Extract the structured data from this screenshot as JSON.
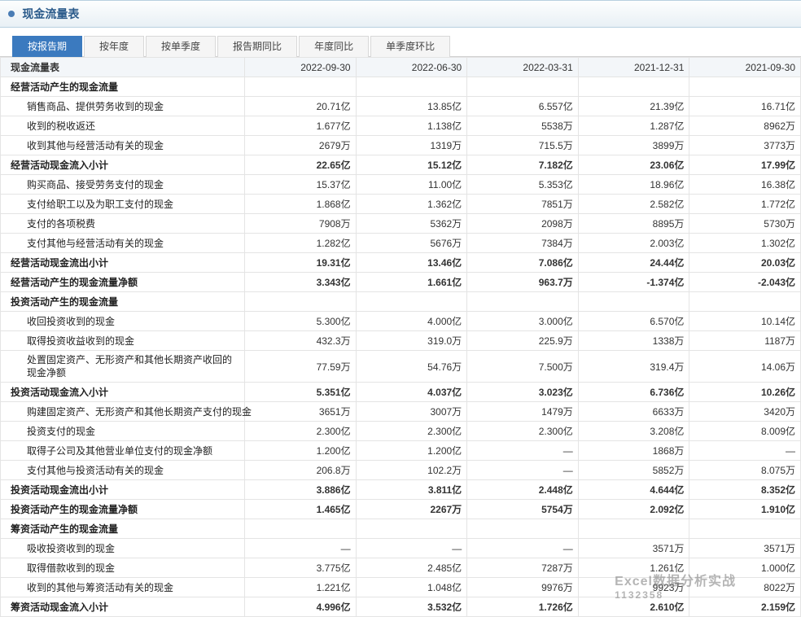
{
  "header": {
    "title": "现金流量表"
  },
  "tabs": [
    {
      "label": "按报告期",
      "active": true
    },
    {
      "label": "按年度",
      "active": false
    },
    {
      "label": "按单季度",
      "active": false
    },
    {
      "label": "报告期同比",
      "active": false
    },
    {
      "label": "年度同比",
      "active": false
    },
    {
      "label": "单季度环比",
      "active": false
    }
  ],
  "table": {
    "header_label": "现金流量表",
    "columns": [
      "2022-09-30",
      "2022-06-30",
      "2022-03-31",
      "2021-12-31",
      "2021-09-30"
    ],
    "rows": [
      {
        "label": "经营活动产生的现金流量",
        "bold": true,
        "indent": 0,
        "values": [
          "",
          "",
          "",
          "",
          ""
        ]
      },
      {
        "label": "销售商品、提供劳务收到的现金",
        "bold": false,
        "indent": 1,
        "values": [
          "20.71亿",
          "13.85亿",
          "6.557亿",
          "21.39亿",
          "16.71亿"
        ]
      },
      {
        "label": "收到的税收返还",
        "bold": false,
        "indent": 1,
        "values": [
          "1.677亿",
          "1.138亿",
          "5538万",
          "1.287亿",
          "8962万"
        ]
      },
      {
        "label": "收到其他与经营活动有关的现金",
        "bold": false,
        "indent": 1,
        "values": [
          "2679万",
          "1319万",
          "715.5万",
          "3899万",
          "3773万"
        ]
      },
      {
        "label": "经营活动现金流入小计",
        "bold": true,
        "indent": 0,
        "values": [
          "22.65亿",
          "15.12亿",
          "7.182亿",
          "23.06亿",
          "17.99亿"
        ]
      },
      {
        "label": "购买商品、接受劳务支付的现金",
        "bold": false,
        "indent": 1,
        "values": [
          "15.37亿",
          "11.00亿",
          "5.353亿",
          "18.96亿",
          "16.38亿"
        ]
      },
      {
        "label": "支付给职工以及为职工支付的现金",
        "bold": false,
        "indent": 1,
        "values": [
          "1.868亿",
          "1.362亿",
          "7851万",
          "2.582亿",
          "1.772亿"
        ]
      },
      {
        "label": "支付的各项税费",
        "bold": false,
        "indent": 1,
        "values": [
          "7908万",
          "5362万",
          "2098万",
          "8895万",
          "5730万"
        ]
      },
      {
        "label": "支付其他与经营活动有关的现金",
        "bold": false,
        "indent": 1,
        "values": [
          "1.282亿",
          "5676万",
          "7384万",
          "2.003亿",
          "1.302亿"
        ]
      },
      {
        "label": "经营活动现金流出小计",
        "bold": true,
        "indent": 0,
        "values": [
          "19.31亿",
          "13.46亿",
          "7.086亿",
          "24.44亿",
          "20.03亿"
        ]
      },
      {
        "label": "经营活动产生的现金流量净额",
        "bold": true,
        "indent": 0,
        "values": [
          "3.343亿",
          "1.661亿",
          "963.7万",
          "-1.374亿",
          "-2.043亿"
        ]
      },
      {
        "label": "投资活动产生的现金流量",
        "bold": true,
        "indent": 0,
        "values": [
          "",
          "",
          "",
          "",
          ""
        ]
      },
      {
        "label": "收回投资收到的现金",
        "bold": false,
        "indent": 1,
        "values": [
          "5.300亿",
          "4.000亿",
          "3.000亿",
          "6.570亿",
          "10.14亿"
        ]
      },
      {
        "label": "取得投资收益收到的现金",
        "bold": false,
        "indent": 1,
        "values": [
          "432.3万",
          "319.0万",
          "225.9万",
          "1338万",
          "1187万"
        ]
      },
      {
        "label": "处置固定资产、无形资产和其他长期资产收回的现金净额",
        "bold": false,
        "indent": 1,
        "wrap": true,
        "values": [
          "77.59万",
          "54.76万",
          "7.500万",
          "319.4万",
          "14.06万"
        ]
      },
      {
        "label": "投资活动现金流入小计",
        "bold": true,
        "indent": 0,
        "values": [
          "5.351亿",
          "4.037亿",
          "3.023亿",
          "6.736亿",
          "10.26亿"
        ]
      },
      {
        "label": "购建固定资产、无形资产和其他长期资产支付的现金",
        "bold": false,
        "indent": 1,
        "values": [
          "3651万",
          "3007万",
          "1479万",
          "6633万",
          "3420万"
        ]
      },
      {
        "label": "投资支付的现金",
        "bold": false,
        "indent": 1,
        "values": [
          "2.300亿",
          "2.300亿",
          "2.300亿",
          "3.208亿",
          "8.009亿"
        ]
      },
      {
        "label": "取得子公司及其他营业单位支付的现金净额",
        "bold": false,
        "indent": 1,
        "values": [
          "1.200亿",
          "1.200亿",
          "—",
          "1868万",
          "—"
        ]
      },
      {
        "label": "支付其他与投资活动有关的现金",
        "bold": false,
        "indent": 1,
        "values": [
          "206.8万",
          "102.2万",
          "—",
          "5852万",
          "8.075万"
        ]
      },
      {
        "label": "投资活动现金流出小计",
        "bold": true,
        "indent": 0,
        "values": [
          "3.886亿",
          "3.811亿",
          "2.448亿",
          "4.644亿",
          "8.352亿"
        ]
      },
      {
        "label": "投资活动产生的现金流量净额",
        "bold": true,
        "indent": 0,
        "values": [
          "1.465亿",
          "2267万",
          "5754万",
          "2.092亿",
          "1.910亿"
        ]
      },
      {
        "label": "筹资活动产生的现金流量",
        "bold": true,
        "indent": 0,
        "values": [
          "",
          "",
          "",
          "",
          ""
        ]
      },
      {
        "label": "吸收投资收到的现金",
        "bold": false,
        "indent": 1,
        "values": [
          "—",
          "—",
          "—",
          "3571万",
          "3571万"
        ]
      },
      {
        "label": "取得借款收到的现金",
        "bold": false,
        "indent": 1,
        "values": [
          "3.775亿",
          "2.485亿",
          "7287万",
          "1.261亿",
          "1.000亿"
        ]
      },
      {
        "label": "收到的其他与筹资活动有关的现金",
        "bold": false,
        "indent": 1,
        "values": [
          "1.221亿",
          "1.048亿",
          "9976万",
          "9923万",
          "8022万"
        ]
      },
      {
        "label": "筹资活动现金流入小计",
        "bold": true,
        "indent": 0,
        "values": [
          "4.996亿",
          "3.532亿",
          "1.726亿",
          "2.610亿",
          "2.159亿"
        ]
      }
    ]
  },
  "watermark": {
    "line1": "Excel数据分析实战",
    "line2": "1132358"
  }
}
